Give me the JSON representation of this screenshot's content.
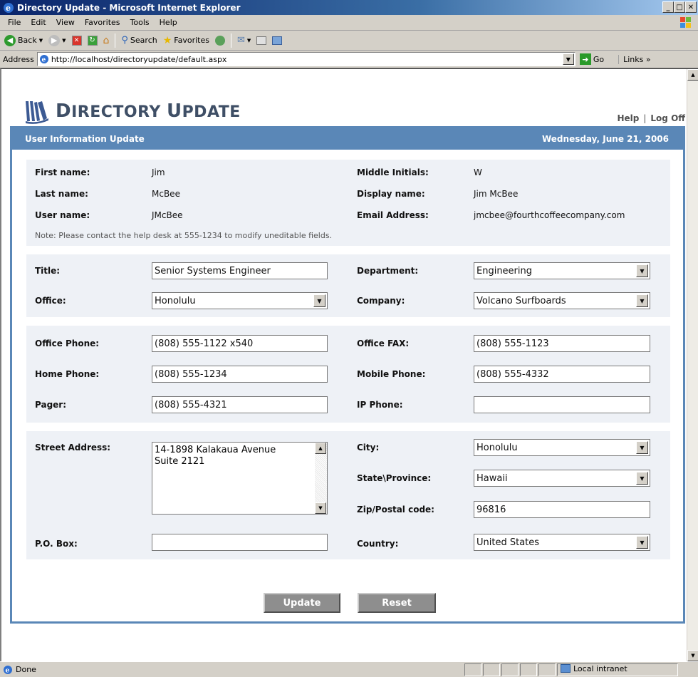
{
  "window": {
    "title": "Directory Update - Microsoft Internet Explorer"
  },
  "menu": [
    "File",
    "Edit",
    "View",
    "Favorites",
    "Tools",
    "Help"
  ],
  "toolbar": {
    "back": "Back",
    "search": "Search",
    "favorites": "Favorites"
  },
  "address": {
    "label": "Address",
    "url": "http://localhost/directoryupdate/default.aspx",
    "go": "Go",
    "links": "Links »"
  },
  "brand": {
    "first_cap": "D",
    "first_rest": "IRECTORY ",
    "second_cap": "U",
    "second_rest": "PDATE"
  },
  "toplinks": {
    "help": "Help",
    "sep": "|",
    "logoff": "Log Off"
  },
  "panel": {
    "title": "User Information Update",
    "date": "Wednesday, June 21, 2006"
  },
  "readonly": {
    "first_name_label": "First name:",
    "first_name": "Jim",
    "middle_label": "Middle Initials:",
    "middle": "W",
    "last_name_label": "Last name:",
    "last_name": "McBee",
    "display_label": "Display name:",
    "display": "Jim McBee",
    "user_label": "User name:",
    "user": "JMcBee",
    "email_label": "Email Address:",
    "email": "jmcbee@fourthcoffeecompany.com",
    "note": "Note: Please contact the help desk at 555-1234 to modify uneditable fields."
  },
  "org": {
    "title_label": "Title:",
    "title": "Senior Systems Engineer",
    "department_label": "Department:",
    "department": "Engineering",
    "office_label": "Office:",
    "office": "Honolulu",
    "company_label": "Company:",
    "company": "Volcano Surfboards"
  },
  "phones": {
    "office_label": "Office Phone:",
    "office": "(808) 555-1122 x540",
    "fax_label": "Office FAX:",
    "fax": "(808) 555-1123",
    "home_label": "Home Phone:",
    "home": "(808) 555-1234",
    "mobile_label": "Mobile Phone:",
    "mobile": "(808) 555-4332",
    "pager_label": "Pager:",
    "pager": "(808) 555-4321",
    "ip_label": "IP Phone:",
    "ip": ""
  },
  "address_form": {
    "street_label": "Street Address:",
    "street_line1": "14-1898 Kalakaua Avenue",
    "street_line2": "Suite 2121",
    "city_label": "City:",
    "city": "Honolulu",
    "state_label": "State\\Province:",
    "state": "Hawaii",
    "zip_label": "Zip/Postal code:",
    "zip": "96816",
    "pobox_label": "P.O. Box:",
    "pobox": "",
    "country_label": "Country:",
    "country": "United States"
  },
  "buttons": {
    "update": "Update",
    "reset": "Reset"
  },
  "status": {
    "text": "Done",
    "zone": "Local intranet"
  }
}
